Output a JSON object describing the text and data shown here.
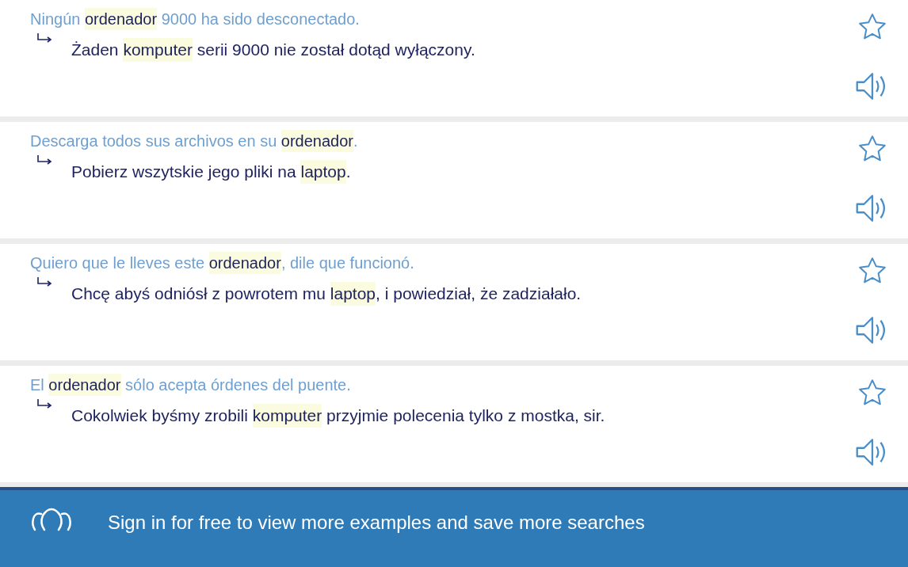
{
  "examples": [
    {
      "source": [
        {
          "text": "Ningún ",
          "highlight": false
        },
        {
          "text": "ordenador",
          "highlight": true
        },
        {
          "text": " 9000 ha sido desconectado.",
          "highlight": false
        }
      ],
      "target": [
        {
          "text": "Żaden ",
          "highlight": false
        },
        {
          "text": "komputer",
          "highlight": true
        },
        {
          "text": " serii 9000 nie został dotąd wyłączony.",
          "highlight": false
        }
      ],
      "starred": false
    },
    {
      "source": [
        {
          "text": "Descarga todos sus archivos en su ",
          "highlight": false
        },
        {
          "text": "ordenador",
          "highlight": true
        },
        {
          "text": ".",
          "highlight": false
        }
      ],
      "target": [
        {
          "text": "Pobierz wszytskie jego pliki na ",
          "highlight": false
        },
        {
          "text": "laptop",
          "highlight": true
        },
        {
          "text": ".",
          "highlight": false
        }
      ],
      "starred": false
    },
    {
      "source": [
        {
          "text": "Quiero que le lleves este ",
          "highlight": false
        },
        {
          "text": "ordenador",
          "highlight": true
        },
        {
          "text": ", dile que funcionó.",
          "highlight": false
        }
      ],
      "target": [
        {
          "text": "Chcę abyś odniósł z powrotem mu ",
          "highlight": false
        },
        {
          "text": "laptop",
          "highlight": true
        },
        {
          "text": ", i powiedział, że zadziałało.",
          "highlight": false
        }
      ],
      "starred": false
    },
    {
      "source": [
        {
          "text": "El ",
          "highlight": false
        },
        {
          "text": "ordenador",
          "highlight": true
        },
        {
          "text": " sólo acepta órdenes del puente.",
          "highlight": false
        }
      ],
      "target": [
        {
          "text": "Cokolwiek byśmy zrobili ",
          "highlight": false
        },
        {
          "text": "komputer",
          "highlight": true
        },
        {
          "text": " przyjmie polecenia tylko z mostka, sir.",
          "highlight": false
        }
      ],
      "starred": false
    }
  ],
  "banner": {
    "text": "Sign in for free to view more examples and save more searches"
  }
}
